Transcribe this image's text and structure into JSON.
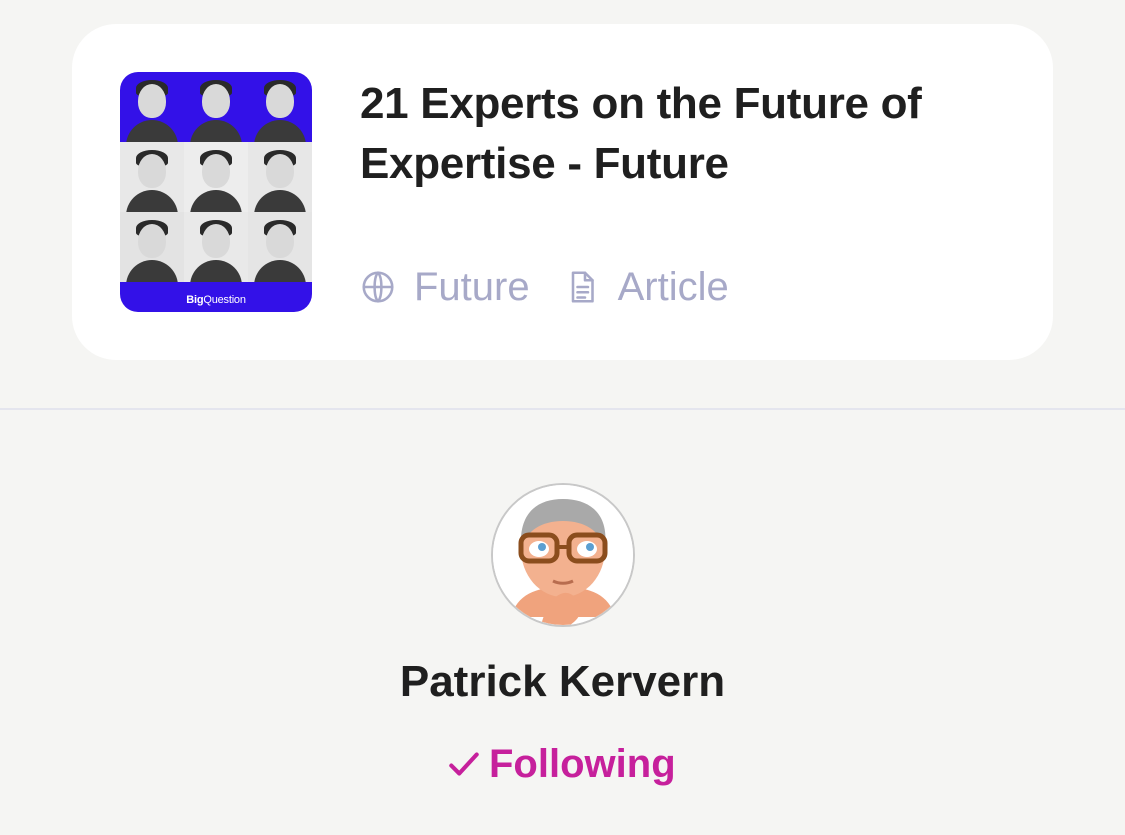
{
  "post": {
    "title": "21 Experts on the Future of Expertise - Future",
    "source": "Future",
    "type": "Article",
    "thumbnail_brand_bold": "Big",
    "thumbnail_brand_rest": "Question"
  },
  "profile": {
    "name": "Patrick Kervern",
    "follow_label": "Following"
  },
  "icons": {
    "source": "globe-icon",
    "type": "document-icon",
    "follow": "check-icon"
  },
  "colors": {
    "background": "#f5f5f3",
    "card": "#ffffff",
    "meta": "#a7a9c8",
    "accent": "#c6209c",
    "thumbnail": "#3311e8"
  }
}
